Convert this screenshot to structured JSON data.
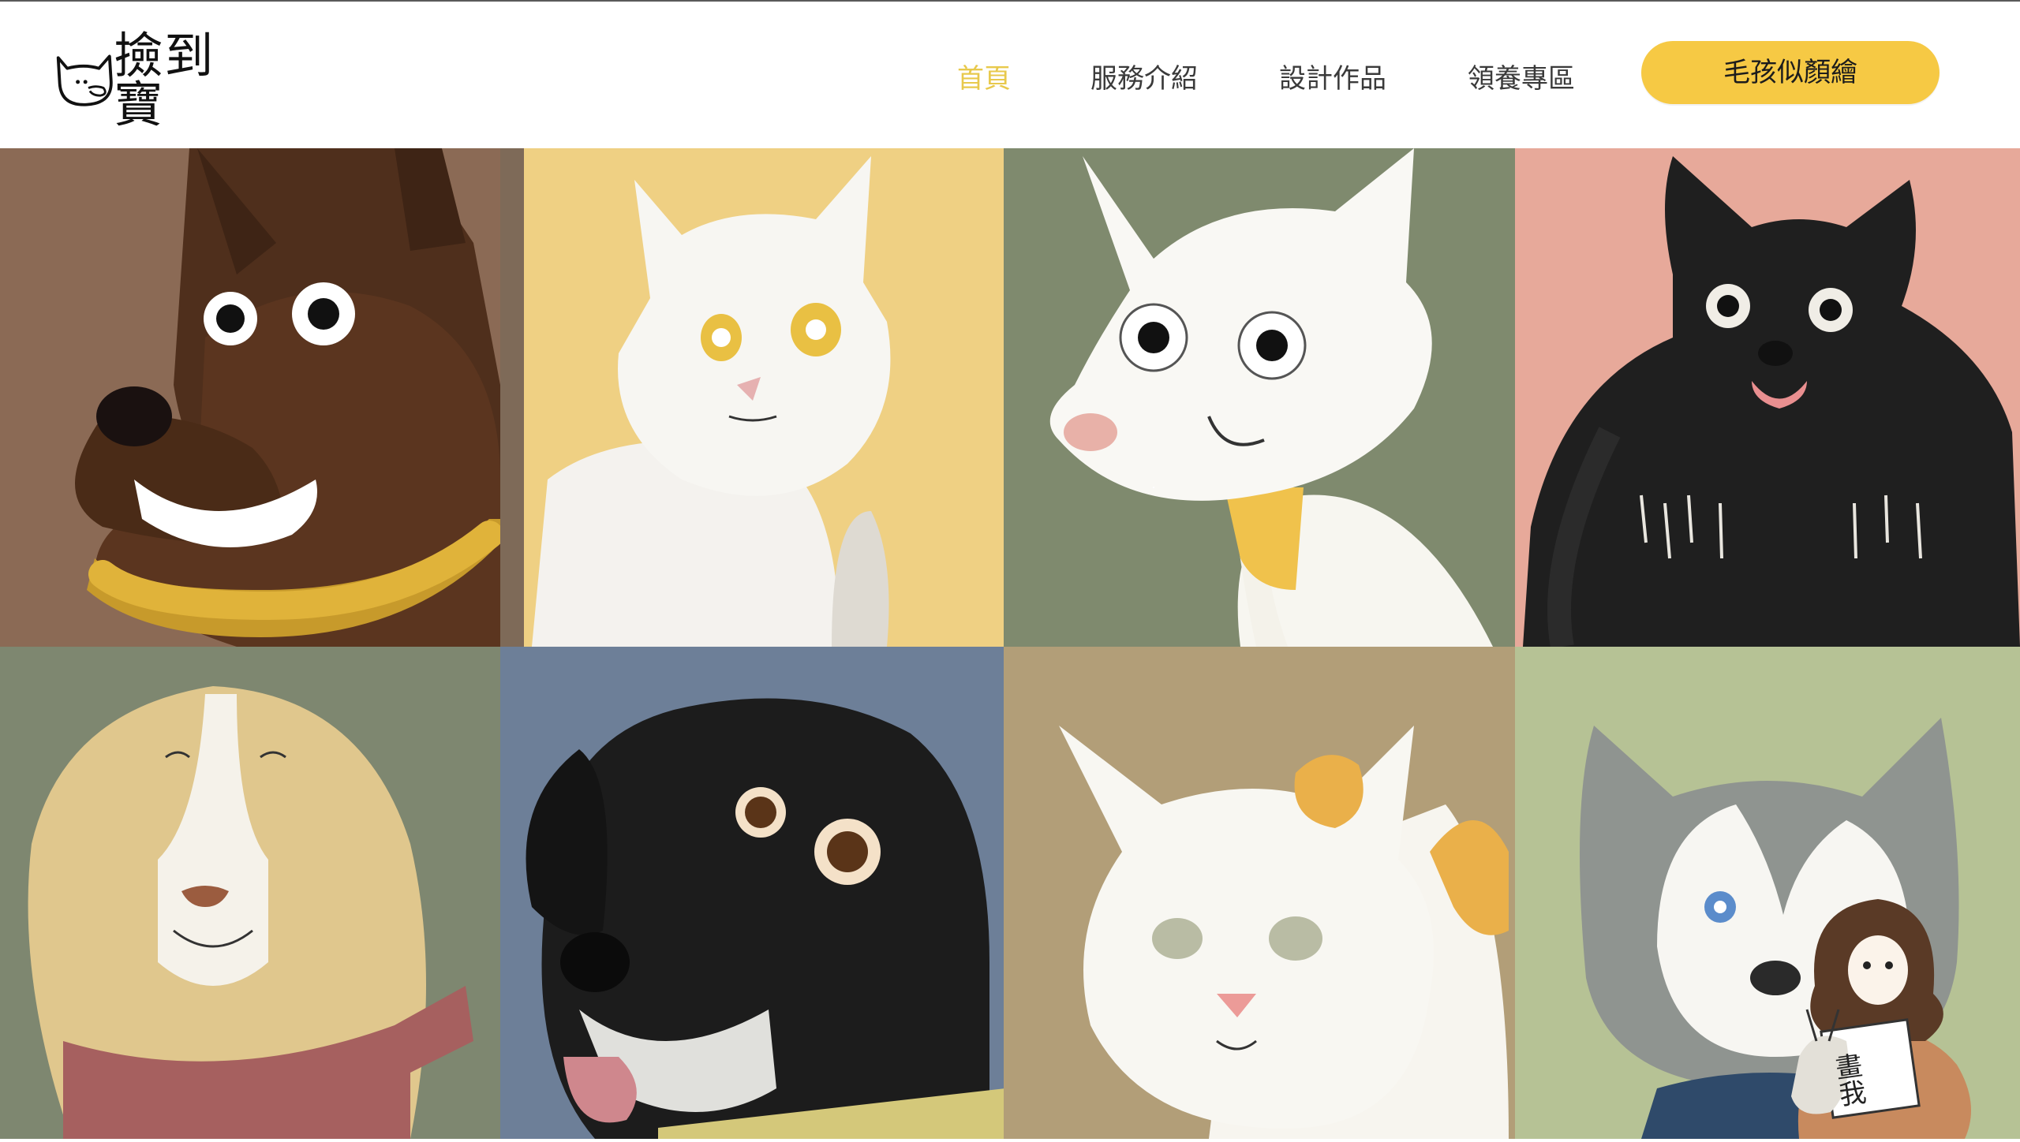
{
  "brand": {
    "logo_text": "撿到寶"
  },
  "nav": {
    "items": [
      {
        "label": "首頁",
        "active": true
      },
      {
        "label": "服務介紹",
        "active": false
      },
      {
        "label": "設計作品",
        "active": false
      },
      {
        "label": "領養專區",
        "active": false
      }
    ],
    "cta_label": "毛孩似顏繪"
  },
  "colors": {
    "accent": "#f6c944",
    "active_nav": "#e8c94c",
    "tile_backgrounds": [
      "#8b6a55",
      "#efd083",
      "#7f8a6e",
      "#e7a99a",
      "#7e8770",
      "#6d7f98",
      "#b29e78",
      "#b6c295"
    ]
  },
  "gallery": {
    "tiles": [
      {
        "animal": "brown-dog-portrait"
      },
      {
        "animal": "white-cat-portrait"
      },
      {
        "animal": "white-dog-portrait"
      },
      {
        "animal": "black-fluffy-dog-portrait"
      },
      {
        "animal": "golden-dog-portrait"
      },
      {
        "animal": "black-labrador-portrait"
      },
      {
        "animal": "calico-cat-portrait"
      },
      {
        "animal": "husky-portrait"
      }
    ],
    "sign_text": "畫我"
  }
}
